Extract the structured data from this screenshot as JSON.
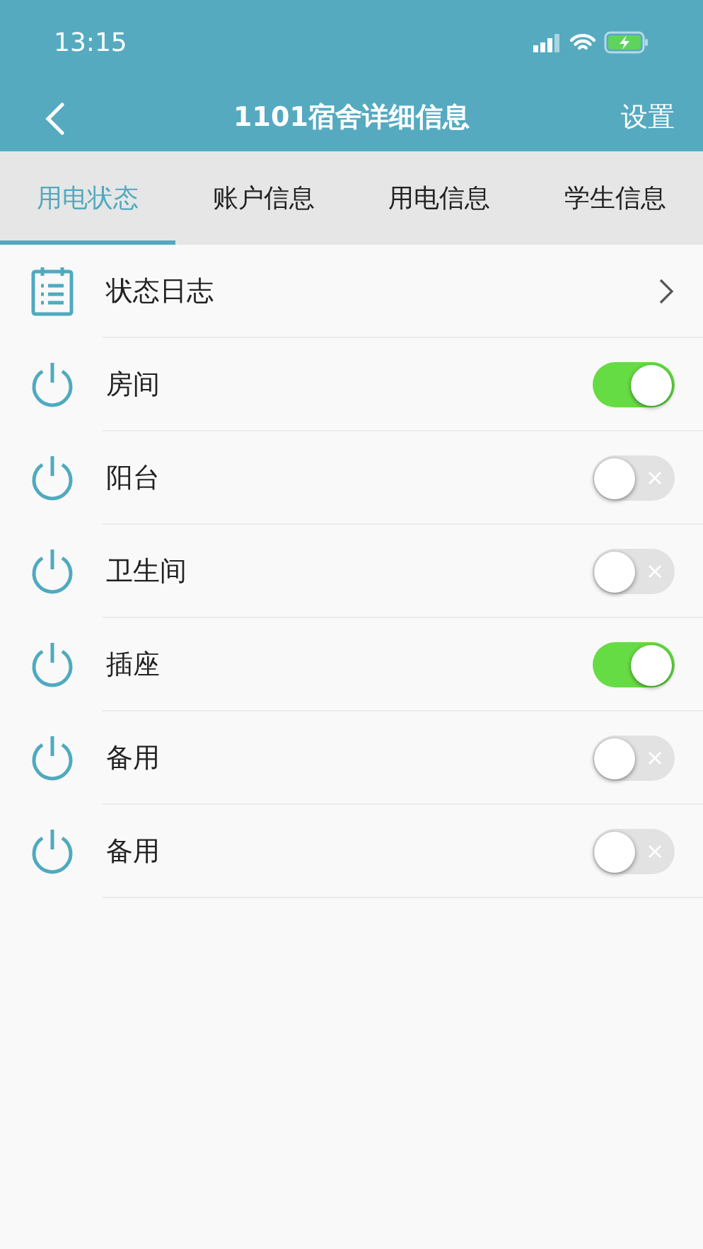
{
  "status_bar": {
    "time": "13:15"
  },
  "nav": {
    "title": "1101宿舍详细信息",
    "action": "设置"
  },
  "tabs": [
    {
      "label": "用电状态",
      "selected": true
    },
    {
      "label": "账户信息",
      "selected": false
    },
    {
      "label": "用电信息",
      "selected": false
    },
    {
      "label": "学生信息",
      "selected": false
    }
  ],
  "rows": [
    {
      "kind": "link",
      "label": "状态日志"
    },
    {
      "kind": "switch",
      "label": "房间",
      "on": true
    },
    {
      "kind": "switch",
      "label": "阳台",
      "on": false
    },
    {
      "kind": "switch",
      "label": "卫生间",
      "on": false
    },
    {
      "kind": "switch",
      "label": "插座",
      "on": true
    },
    {
      "kind": "switch",
      "label": "备用",
      "on": false
    },
    {
      "kind": "switch",
      "label": "备用",
      "on": false
    }
  ]
}
